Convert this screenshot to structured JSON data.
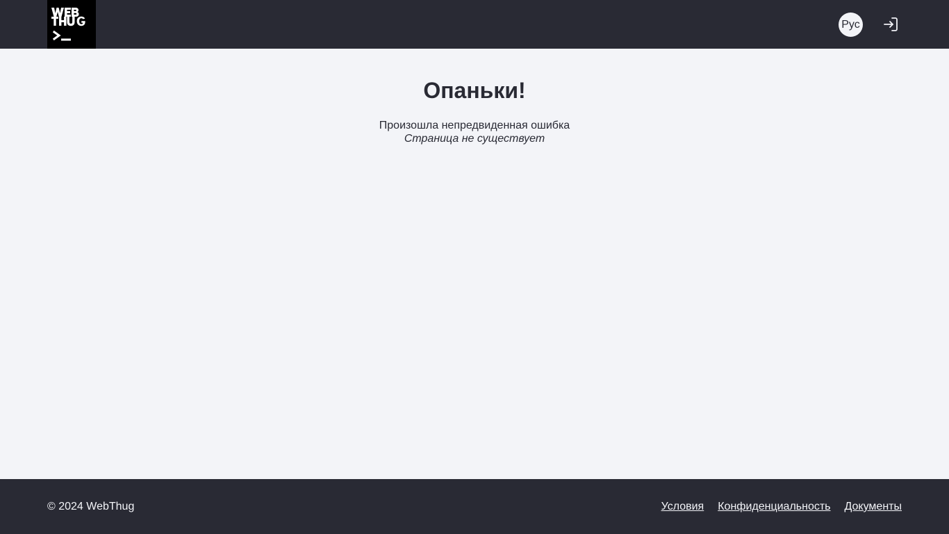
{
  "header": {
    "logo": {
      "text_line1": "WEB",
      "text_line2": "THUG",
      "prompt": ">_",
      "icon": "webthug-logo"
    },
    "language_label": "Рус",
    "login_icon": "login-icon"
  },
  "main": {
    "title": "Опаньки!",
    "message": "Произошла непредвиденная ошибка",
    "detail": "Страница не существует"
  },
  "footer": {
    "copyright": "© 2024 WebThug",
    "links": [
      {
        "label": "Условия"
      },
      {
        "label": "Конфиденциальность"
      },
      {
        "label": "Документы"
      }
    ]
  },
  "colors": {
    "header_bg": "#292a34",
    "page_bg": "#f3f4f8",
    "logo_bg": "#000000",
    "text": "#292a34",
    "footer_text": "#f3f4f8"
  }
}
